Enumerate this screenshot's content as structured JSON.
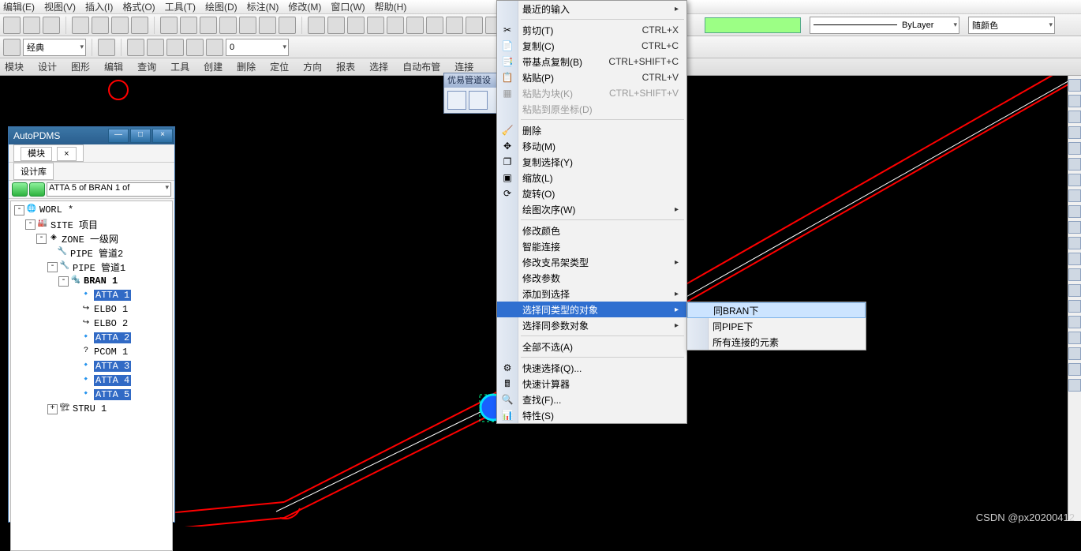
{
  "menubar": [
    "编辑(E)",
    "视图(V)",
    "插入(I)",
    "格式(O)",
    "工具(T)",
    "绘图(D)",
    "标注(N)",
    "修改(M)",
    "窗口(W)",
    "帮助(H)"
  ],
  "classic_label": "经典",
  "layer_dropdown": "ByLayer",
  "search_placeholder": "",
  "linetype_label": "ByLayer",
  "color_label": "随颜色",
  "tabs": [
    "模块",
    "设计",
    "图形",
    "编辑",
    "查询",
    "工具",
    "创建",
    "删除",
    "定位",
    "方向",
    "报表",
    "选择",
    "自动布管",
    "连接"
  ],
  "sidepanel": {
    "title": "AutoPDMS",
    "module_tab": "模块",
    "module_close": "×",
    "design_tab": "设计库",
    "breadcrumb": "ATTA 5 of BRAN 1 of "
  },
  "tree": {
    "worl": "WORL *",
    "site": "SITE 项目",
    "zone": "ZONE 一级网",
    "pipe2": "PIPE 管道2",
    "pipe1": "PIPE 管道1",
    "bran1": "BRAN 1",
    "items": [
      "ATTA 1",
      "ELBO 1",
      "ELBO 2",
      "ATTA 2",
      "PCOM 1",
      "ATTA 3",
      "ATTA 4",
      "ATTA 5"
    ],
    "stru1": "STRU 1"
  },
  "contextmenu": {
    "recent_input": "最近的输入",
    "cut": "剪切(T)",
    "cut_sc": "CTRL+X",
    "copy": "复制(C)",
    "copy_sc": "CTRL+C",
    "copy_base": "带基点复制(B)",
    "copy_base_sc": "CTRL+SHIFT+C",
    "paste": "粘贴(P)",
    "paste_sc": "CTRL+V",
    "paste_block": "粘贴为块(K)",
    "paste_block_sc": "CTRL+SHIFT+V",
    "paste_orig": "粘贴到原坐标(D)",
    "delete": "删除",
    "move": "移动(M)",
    "copysel": "复制选择(Y)",
    "scale": "缩放(L)",
    "rotate": "旋转(O)",
    "draworder": "绘图次序(W)",
    "modcolor": "修改颜色",
    "smartconn": "智能连接",
    "modsupport": "修改支吊架类型",
    "modparam": "修改参数",
    "addtosel": "添加到选择",
    "seltype": "选择同类型的对象",
    "selparam": "选择同参数对象",
    "deselectall": "全部不选(A)",
    "quicksel": "快速选择(Q)...",
    "quickcalc": "快速计算器",
    "find": "查找(F)...",
    "properties": "特性(S)"
  },
  "submenu": {
    "bran": "同BRAN下",
    "pipe": "同PIPE下",
    "all": "所有连接的元素"
  },
  "floater_title": "优易管道设计",
  "watermark": "CSDN @px20200412"
}
